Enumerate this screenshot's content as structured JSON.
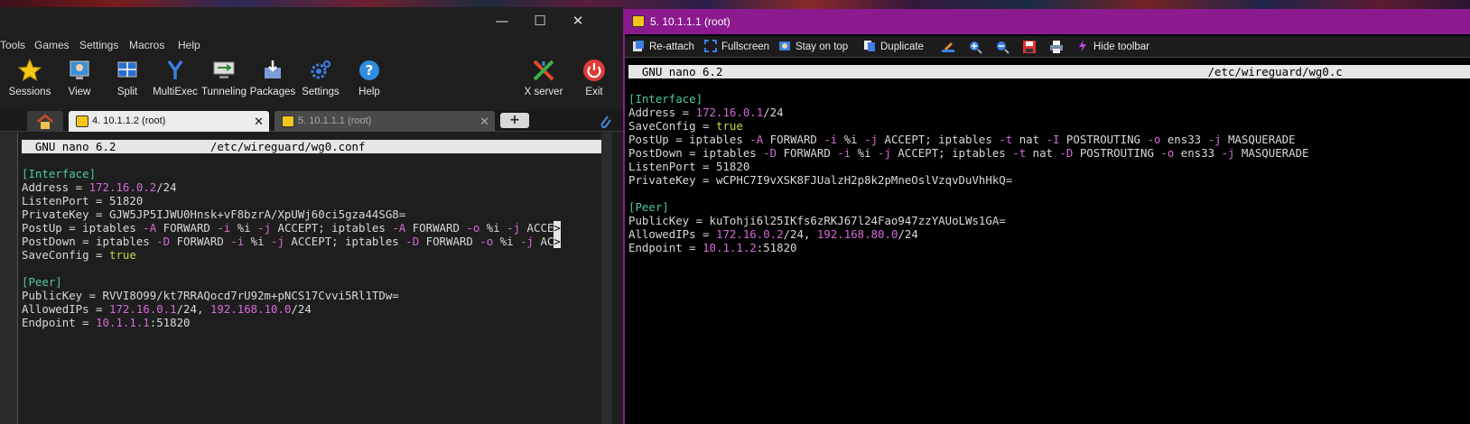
{
  "left_window": {
    "controls": {
      "minimize": "—",
      "maximize": "☐",
      "close": "✕"
    },
    "menu": [
      "Tools",
      "Games",
      "Settings",
      "Macros",
      "Help"
    ],
    "toolbar": [
      {
        "label": "Sessions",
        "icon": "star-icon"
      },
      {
        "label": "View",
        "icon": "view-icon"
      },
      {
        "label": "Split",
        "icon": "split-icon"
      },
      {
        "label": "MultiExec",
        "icon": "multiexec-icon"
      },
      {
        "label": "Tunneling",
        "icon": "tunneling-icon"
      },
      {
        "label": "Packages",
        "icon": "packages-icon"
      },
      {
        "label": "Settings",
        "icon": "gear-icon"
      },
      {
        "label": "Help",
        "icon": "help-icon"
      },
      {
        "label": "X server",
        "icon": "x-server-icon"
      },
      {
        "label": "Exit",
        "icon": "power-icon"
      }
    ],
    "tabs": [
      {
        "label": "4. 10.1.1.2 (root)",
        "close": "✕",
        "active": true
      },
      {
        "label": "5. 10.1.1.1 (root)",
        "close": "✕",
        "active": false
      }
    ],
    "terminal": {
      "nano_version": "GNU nano 6.2",
      "file_path": "/etc/wireguard/wg0.conf",
      "section_interface": "[Interface]",
      "address_key": "Address = ",
      "address_ip": "172.16.0.2",
      "address_mask": "/24",
      "listen_port": "ListenPort = 51820",
      "private_key": "PrivateKey = GJW5JP5IJWU0Hnsk+vF8bzrA/XpUWj60ci5gza44SG8=",
      "postup_a": "PostUp = iptables ",
      "postup_flag1": "-A",
      "postup_b": " FORWARD ",
      "postup_flag2": "-i",
      "postup_c": " %i ",
      "postup_flag3": "-j",
      "postup_d": " ACCEPT; iptables ",
      "postup_flag4": "-A",
      "postup_e": " FORWARD ",
      "postup_flag5": "-o",
      "postup_f": " %i ",
      "postup_flag6": "-j",
      "postup_g": " ACCE",
      "postdown_a": "PostDown = iptables ",
      "postdown_flag1": "-D",
      "postdown_b": " FORWARD ",
      "postdown_flag2": "-i",
      "postdown_c": " %i ",
      "postdown_flag3": "-j",
      "postdown_d": " ACCEPT; iptables ",
      "postdown_flag4": "-D",
      "postdown_e": " FORWARD ",
      "postdown_flag5": "-o",
      "postdown_f": " %i ",
      "postdown_flag6": "-j",
      "postdown_g": " AC",
      "overflow_marker": ">",
      "saveconfig_key": "SaveConfig = ",
      "saveconfig_val": "true",
      "section_peer": "[Peer]",
      "public_key": "PublicKey = RVVI8O99/kt7RRAQocd7rU92m+pNCS17Cvvi5Rl1TDw=",
      "allowed_key": "AllowedIPs = ",
      "allowed_ip1": "172.16.0.1",
      "allowed_mask1": "/24, ",
      "allowed_ip2": "192.168.10.0",
      "allowed_mask2": "/24",
      "endpoint_key": "Endpoint = ",
      "endpoint_ip": "10.1.1.1",
      "endpoint_port": ":51820"
    }
  },
  "right_window": {
    "title": "5. 10.1.1.1 (root)",
    "toolbar": [
      "Re-attach",
      "Fullscreen",
      "Stay on top",
      "Duplicate",
      "Hide toolbar"
    ],
    "terminal": {
      "nano_version": "GNU nano 6.2",
      "file_path": "/etc/wireguard/wg0.c",
      "section_interface": "[Interface]",
      "address_key": "Address = ",
      "address_ip": "172.16.0.1",
      "address_mask": "/24",
      "saveconfig_key": "SaveConfig = ",
      "saveconfig_val": "true",
      "postup_a": "PostUp = iptables ",
      "postup_flag1": "-A",
      "postup_b": " FORWARD ",
      "postup_flag2": "-i",
      "postup_c": " %i ",
      "postup_flag3": "-j",
      "postup_d": " ACCEPT; iptables ",
      "postup_flag4": "-t",
      "postup_e": " nat ",
      "postup_flag5": "-I",
      "postup_f": " POSTROUTING ",
      "postup_flag6": "-o",
      "postup_g": " ens33 ",
      "postup_flag7": "-j",
      "postup_h": " MASQUERADE",
      "postdown_a": "PostDown = iptables ",
      "postdown_flag1": "-D",
      "postdown_b": " FORWARD ",
      "postdown_flag2": "-i",
      "postdown_c": " %i ",
      "postdown_flag3": "-j",
      "postdown_d": " ACCEPT; iptables ",
      "postdown_flag4": "-t",
      "postdown_e": " nat ",
      "postdown_flag5": "-D",
      "postdown_f": " POSTROUTING ",
      "postdown_flag6": "-o",
      "postdown_g": " ens33 ",
      "postdown_flag7": "-j",
      "postdown_h": " MASQUERADE",
      "listen_port": "ListenPort = 51820",
      "private_key": "PrivateKey = wCPHC7I9vXSK8FJUalzH2p8k2pMneOslVzqvDuVhHkQ=",
      "section_peer": "[Peer]",
      "public_key": "PublicKey = kuTohji6l25IKfs6zRKJ67l24Fao947zzYAUoLWs1GA=",
      "allowed_key": "AllowedIPs = ",
      "allowed_ip1": "172.16.0.2",
      "allowed_mask1": "/24, ",
      "allowed_ip2": "192.168.80.0",
      "allowed_mask2": "/24",
      "endpoint_key": "Endpoint = ",
      "endpoint_ip": "10.1.1.2",
      "endpoint_port": ":51820"
    }
  },
  "colors": {
    "right_title_bg": "#8b1a8f",
    "syntax_green": "#4ec9a0",
    "syntax_magenta": "#d66ad9",
    "syntax_yellow": "#c8d84a"
  }
}
